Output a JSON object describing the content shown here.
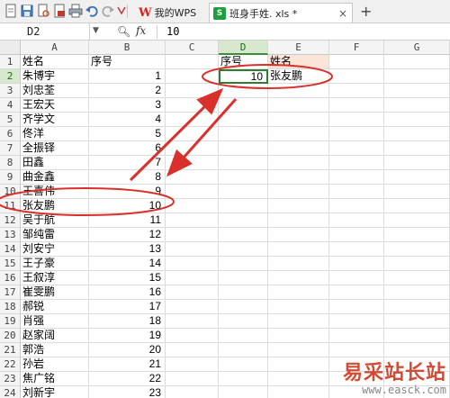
{
  "tabs": {
    "wps_label": "我的WPS",
    "file_label": "班身手姓. xls *",
    "file_icon_text": "S",
    "close_glyph": "×",
    "new_tab_glyph": "+"
  },
  "formula_bar": {
    "cell_ref": "D2",
    "fx_label": "fx",
    "value": "10"
  },
  "columns": [
    "A",
    "B",
    "C",
    "D",
    "E",
    "F",
    "G"
  ],
  "active_column": "D",
  "active_row": 2,
  "rows": [
    {
      "n": "1",
      "a": "姓名",
      "b": "序号"
    },
    {
      "n": "2",
      "a": "朱博宇",
      "b": "1"
    },
    {
      "n": "3",
      "a": "刘忠荃",
      "b": "2"
    },
    {
      "n": "4",
      "a": "王宏天",
      "b": "3"
    },
    {
      "n": "5",
      "a": "齐学文",
      "b": "4"
    },
    {
      "n": "6",
      "a": "佟洋",
      "b": "5"
    },
    {
      "n": "7",
      "a": "全振铎",
      "b": "6"
    },
    {
      "n": "8",
      "a": "田鑫",
      "b": "7"
    },
    {
      "n": "9",
      "a": "曲金鑫",
      "b": "8"
    },
    {
      "n": "10",
      "a": "王喜伟",
      "b": "9"
    },
    {
      "n": "11",
      "a": "张友鹏",
      "b": "10"
    },
    {
      "n": "12",
      "a": "吴于航",
      "b": "11"
    },
    {
      "n": "13",
      "a": "邹纯雷",
      "b": "12"
    },
    {
      "n": "14",
      "a": "刘安宁",
      "b": "13"
    },
    {
      "n": "15",
      "a": "王子豪",
      "b": "14"
    },
    {
      "n": "16",
      "a": "王叙淳",
      "b": "15"
    },
    {
      "n": "17",
      "a": "崔雯鹏",
      "b": "16"
    },
    {
      "n": "18",
      "a": "郝锐",
      "b": "17"
    },
    {
      "n": "19",
      "a": "肖强",
      "b": "18"
    },
    {
      "n": "20",
      "a": "赵家阔",
      "b": "19"
    },
    {
      "n": "21",
      "a": "郭浩",
      "b": "20"
    },
    {
      "n": "22",
      "a": "孙岩",
      "b": "21"
    },
    {
      "n": "23",
      "a": "焦广铭",
      "b": "22"
    },
    {
      "n": "24",
      "a": "刘新宇",
      "b": "23"
    },
    {
      "n": "25",
      "a": "毕立坤",
      "b": "24"
    }
  ],
  "lookup": {
    "header_d": "序号",
    "header_e": "姓名",
    "value_d": "10",
    "value_e": "张友鹏"
  },
  "watermark": {
    "title": "易采站长站",
    "url": "www.easck.com"
  },
  "colors": {
    "annotation": "#d9302c",
    "selection": "#2e7d32",
    "active_header": "#d8e8ce"
  }
}
